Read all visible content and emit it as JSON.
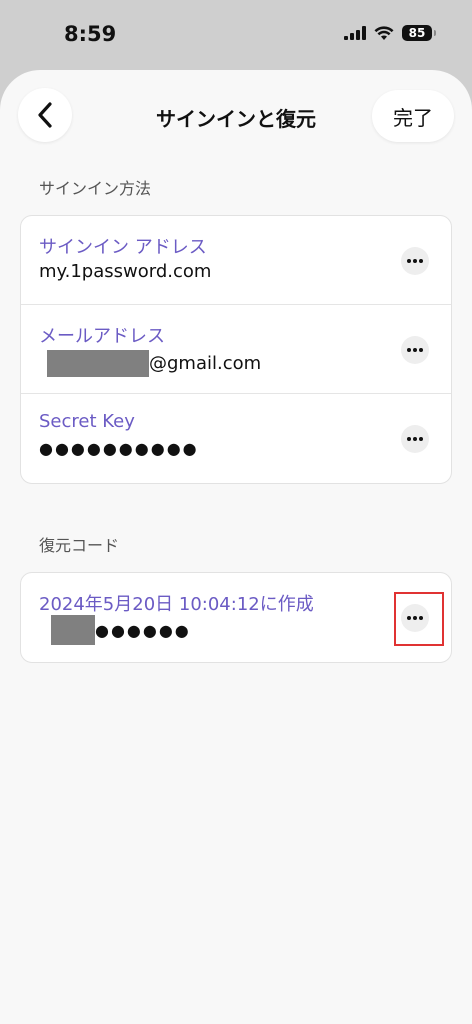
{
  "status_bar": {
    "time": "8:59",
    "battery": "85"
  },
  "header": {
    "title": "サインインと復元",
    "done_label": "完了"
  },
  "signin_section": {
    "heading": "サインイン方法",
    "rows": [
      {
        "label": "サインイン アドレス",
        "value": "my.1password.com"
      },
      {
        "label": "メールアドレス",
        "value": "@gmail.com"
      },
      {
        "label": "Secret Key",
        "value": "●●●●●●●●●●"
      }
    ]
  },
  "recovery_section": {
    "heading": "復元コード",
    "rows": [
      {
        "label": "2024年5月20日 10:04:12に作成",
        "value": "●●●●●●"
      }
    ]
  },
  "colors": {
    "accent_label": "#6b5bc4",
    "highlight": "#e03232"
  }
}
